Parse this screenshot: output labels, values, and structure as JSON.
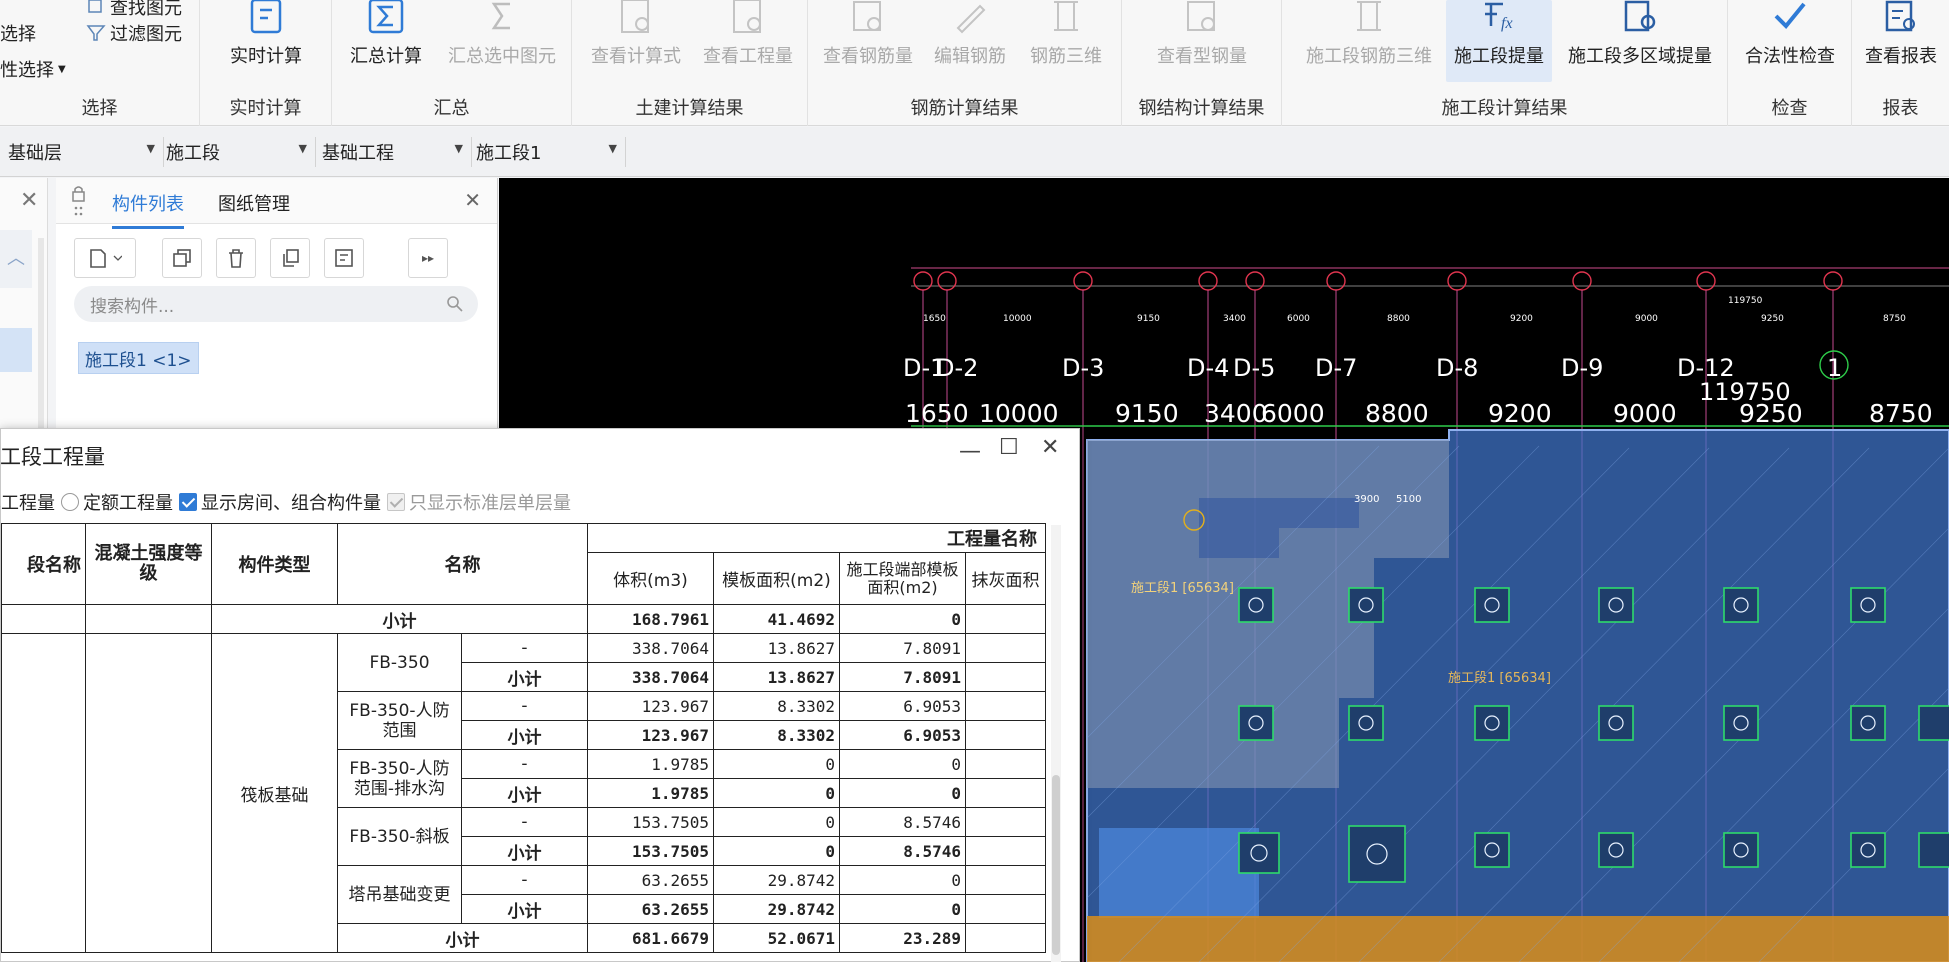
{
  "ribbon": {
    "select_group": {
      "items": [
        "选择",
        "性选择",
        "查找图元",
        "过滤图元"
      ],
      "title": "选择"
    },
    "groups": [
      {
        "title": "实时计算",
        "buttons": [
          {
            "label": "实时计算",
            "icon": "realtime-calc-icon",
            "state": "normal"
          }
        ]
      },
      {
        "title": "汇总",
        "buttons": [
          {
            "label": "汇总计算",
            "icon": "sum-icon",
            "state": "normal"
          },
          {
            "label": "汇总选中图元",
            "icon": "sum-selected-icon",
            "state": "disabled"
          }
        ]
      },
      {
        "title": "土建计算结果",
        "buttons": [
          {
            "label": "查看计算式",
            "icon": "view-formula-icon",
            "state": "disabled"
          },
          {
            "label": "查看工程量",
            "icon": "view-quantity-icon",
            "state": "disabled"
          }
        ]
      },
      {
        "title": "钢筋计算结果",
        "buttons": [
          {
            "label": "查看钢筋量",
            "icon": "view-rebar-icon",
            "state": "disabled"
          },
          {
            "label": "编辑钢筋",
            "icon": "edit-rebar-icon",
            "state": "disabled"
          },
          {
            "label": "钢筋三维",
            "icon": "rebar-3d-icon",
            "state": "disabled"
          }
        ]
      },
      {
        "title": "钢结构计算结果",
        "buttons": [
          {
            "label": "查看型钢量",
            "icon": "view-steel-icon",
            "state": "disabled"
          }
        ]
      },
      {
        "title": "施工段计算结果",
        "buttons": [
          {
            "label": "施工段钢筋三维",
            "icon": "section-rebar-3d-icon",
            "state": "disabled"
          },
          {
            "label": "施工段提量",
            "icon": "section-quantity-icon",
            "state": "selected"
          },
          {
            "label": "施工段多区域提量",
            "icon": "section-multi-quantity-icon",
            "state": "normal"
          }
        ]
      },
      {
        "title": "检查",
        "buttons": [
          {
            "label": "合法性检查",
            "icon": "check-icon",
            "state": "normal"
          }
        ]
      },
      {
        "title": "报表",
        "buttons": [
          {
            "label": "查看报表",
            "icon": "report-icon",
            "state": "normal"
          }
        ]
      }
    ]
  },
  "layerbar": {
    "dropdowns": [
      "基础层",
      "施工段",
      "基础工程",
      "施工段1"
    ]
  },
  "component_panel": {
    "tabs": [
      "构件列表",
      "图纸管理"
    ],
    "search_placeholder": "搜索构件...",
    "selected_item": "施工段1 <1>"
  },
  "cad": {
    "axis_numbers_small": [
      "1650",
      "10000",
      "9150",
      "3400",
      "6000",
      "8800",
      "9200",
      "9000",
      "9250",
      "8750",
      "119750"
    ],
    "axis_labels": [
      "D-1",
      "D-2",
      "D-3",
      "D-4",
      "D-5",
      "D-7",
      "D-8",
      "D-9",
      "D-12",
      "1"
    ],
    "dim_values": [
      "1650",
      "10000",
      "9150",
      "3400",
      "6000",
      "8800",
      "9200",
      "9000",
      "9250",
      "8750"
    ],
    "total_dim": "119750",
    "small_dims": [
      "3900",
      "5100"
    ],
    "region_label_a": "施工段1 [65634]",
    "region_label_b": "施工段1 [65634]"
  },
  "dialog": {
    "title": "施工段工程量",
    "options": {
      "option1": "单工程量",
      "option2": "定额工程量",
      "option3": "显示房间、组合构件量",
      "option4": "只显示标准层单层量"
    },
    "headers": {
      "col_section": "段名称",
      "col_concrete": "混凝土强度等级",
      "col_type": "构件类型",
      "col_name": "名称",
      "group_title": "工程量名称",
      "volume": "体积(m3)",
      "formwork": "模板面积(m2)",
      "end_formwork": "施工段端部模板面积(m2)",
      "plaster": "抹灰面积"
    },
    "subtotal_label": "小计",
    "first_subtotal": {
      "volume": "168.7961",
      "formwork": "41.4692",
      "end": "0"
    },
    "component_type": "筏板基础",
    "items": [
      {
        "name": "FB-350",
        "detail": {
          "sub": "-",
          "volume": "338.7064",
          "formwork": "13.8627",
          "end": "7.8091"
        },
        "subtotal": {
          "volume": "338.7064",
          "formwork": "13.8627",
          "end": "7.8091"
        }
      },
      {
        "name": "FB-350-人防范围",
        "detail": {
          "sub": "-",
          "volume": "123.967",
          "formwork": "8.3302",
          "end": "6.9053"
        },
        "subtotal": {
          "volume": "123.967",
          "formwork": "8.3302",
          "end": "6.9053"
        }
      },
      {
        "name": "FB-350-人防范围-排水沟",
        "detail": {
          "sub": "-",
          "volume": "1.9785",
          "formwork": "0",
          "end": "0"
        },
        "subtotal": {
          "volume": "1.9785",
          "formwork": "0",
          "end": "0"
        }
      },
      {
        "name": "FB-350-斜板",
        "detail": {
          "sub": "-",
          "volume": "153.7505",
          "formwork": "0",
          "end": "8.5746"
        },
        "subtotal": {
          "volume": "153.7505",
          "formwork": "0",
          "end": "8.5746"
        }
      },
      {
        "name": "塔吊基础变更",
        "detail": {
          "sub": "-",
          "volume": "63.2655",
          "formwork": "29.8742",
          "end": "0"
        },
        "subtotal": {
          "volume": "63.2655",
          "formwork": "29.8742",
          "end": "0"
        }
      }
    ],
    "type_subtotal": {
      "volume": "681.6679",
      "formwork": "52.0671",
      "end": "23.289"
    }
  }
}
